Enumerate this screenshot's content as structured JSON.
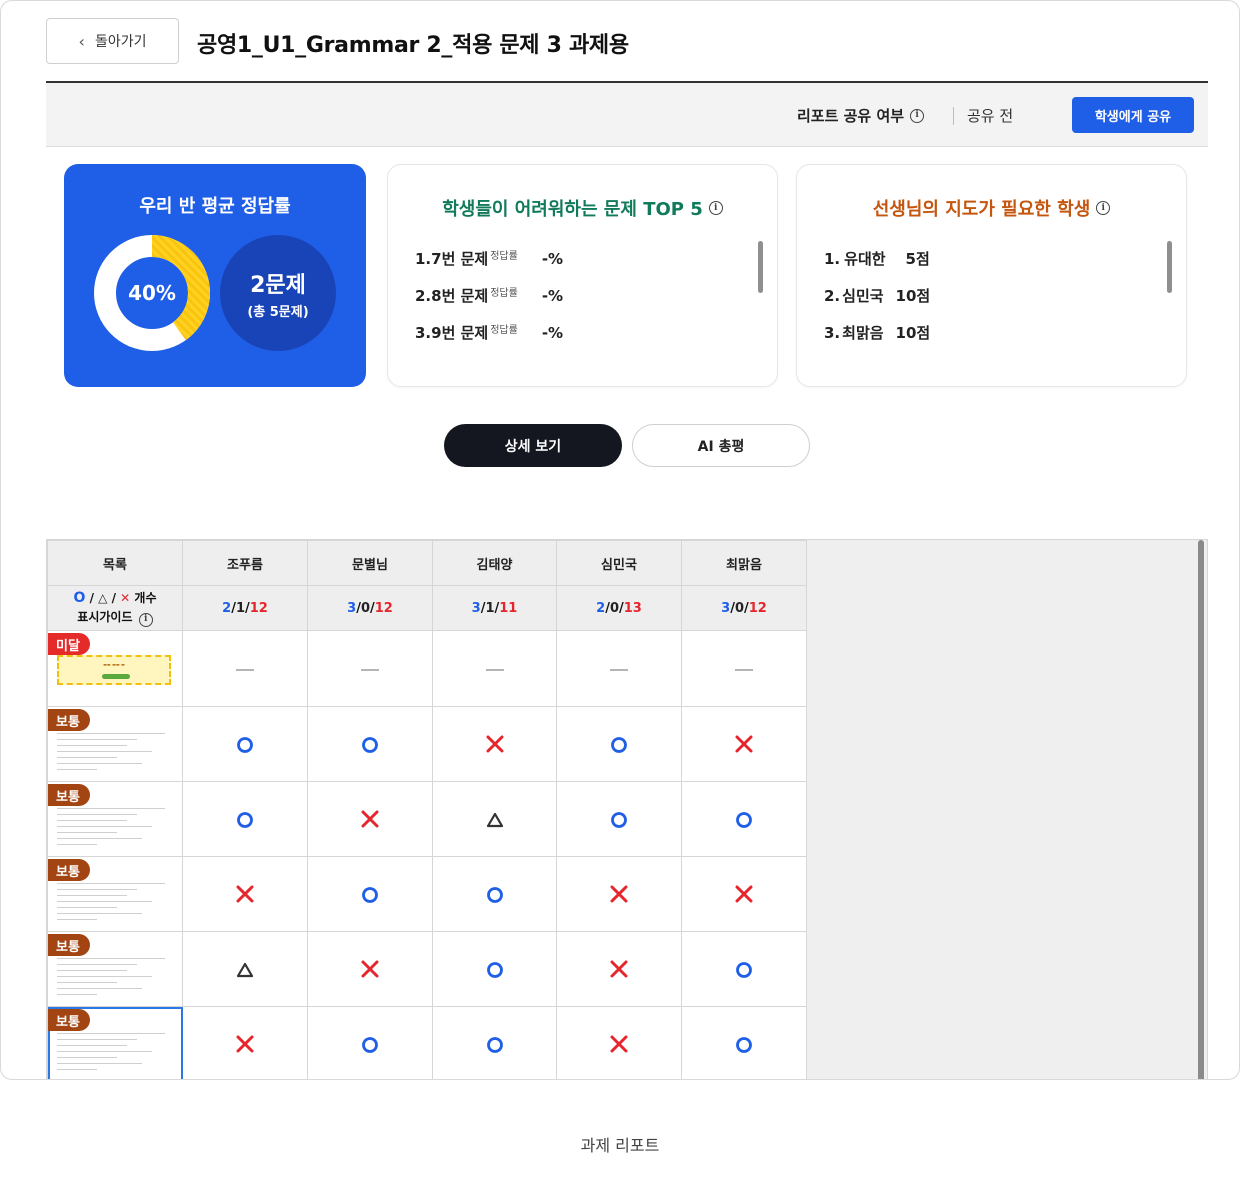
{
  "header": {
    "back_label": "돌아가기",
    "title": "공영1_U1_Grammar 2_적용 문제 3 과제용"
  },
  "share": {
    "label": "리포트 공유 여부",
    "status": "공유 전",
    "button_label": "학생에게 공유"
  },
  "avg_card": {
    "title": "우리 반 평균 정답률",
    "rate_label": "40%",
    "rate_value": 40,
    "count_main": "2문제",
    "count_sub": "(총 5문제)",
    "colors": {
      "card": "#1f5ee6",
      "ring": "#ffffff",
      "fill": "#ffd21f"
    }
  },
  "top5_card": {
    "title": "학생들이 어려워하는 문제 TOP 5",
    "sub_label": "정답률",
    "items": [
      {
        "label": "1.7번 문제",
        "value": "-%"
      },
      {
        "label": "2.8번 문제",
        "value": "-%"
      },
      {
        "label": "3.9번 문제",
        "value": "-%"
      }
    ]
  },
  "guide_card": {
    "title": "선생님의 지도가 필요한 학생",
    "items": [
      {
        "rank": "1.",
        "name": "유대한",
        "score": "5점"
      },
      {
        "rank": "2.",
        "name": "심민국",
        "score": "10점"
      },
      {
        "rank": "3.",
        "name": "최맑음",
        "score": "10점"
      }
    ]
  },
  "tabs": {
    "detail": "상세 보기",
    "ai": "AI 총평"
  },
  "table": {
    "header_first": "목록",
    "students": [
      "조푸름",
      "문별님",
      "김태양",
      "심민국",
      "최맑음"
    ],
    "legend": {
      "circle": "O",
      "slash": "/",
      "triangle": "△",
      "cross": "✕",
      "count": "개수",
      "guide": "표시가이드"
    },
    "summary": [
      {
        "o": "2",
        "t": "1",
        "x": "12"
      },
      {
        "o": "3",
        "t": "0",
        "x": "12"
      },
      {
        "o": "3",
        "t": "1",
        "x": "11"
      },
      {
        "o": "2",
        "t": "0",
        "x": "13"
      },
      {
        "o": "3",
        "t": "0",
        "x": "12"
      }
    ],
    "summary_sep": "/",
    "rows": [
      {
        "level": "미달",
        "level_type": "low",
        "marks": [
          "dash",
          "dash",
          "dash",
          "dash",
          "dash"
        ]
      },
      {
        "level": "보통",
        "level_type": "mid",
        "marks": [
          "o",
          "o",
          "x",
          "o",
          "x"
        ]
      },
      {
        "level": "보통",
        "level_type": "mid",
        "marks": [
          "o",
          "x",
          "t",
          "o",
          "o"
        ]
      },
      {
        "level": "보통",
        "level_type": "mid",
        "marks": [
          "x",
          "o",
          "o",
          "x",
          "x"
        ]
      },
      {
        "level": "보통",
        "level_type": "mid",
        "marks": [
          "t",
          "x",
          "o",
          "x",
          "o"
        ]
      },
      {
        "level": "보통",
        "level_type": "mid",
        "marks": [
          "x",
          "o",
          "o",
          "x",
          "o"
        ]
      }
    ],
    "selected_row": 5
  },
  "caption": "과제 리포트",
  "colors": {
    "blue": "#1f5ee6",
    "red": "#e5262d",
    "mid_tag": "#a24512",
    "low_tag": "#e52a2a"
  }
}
